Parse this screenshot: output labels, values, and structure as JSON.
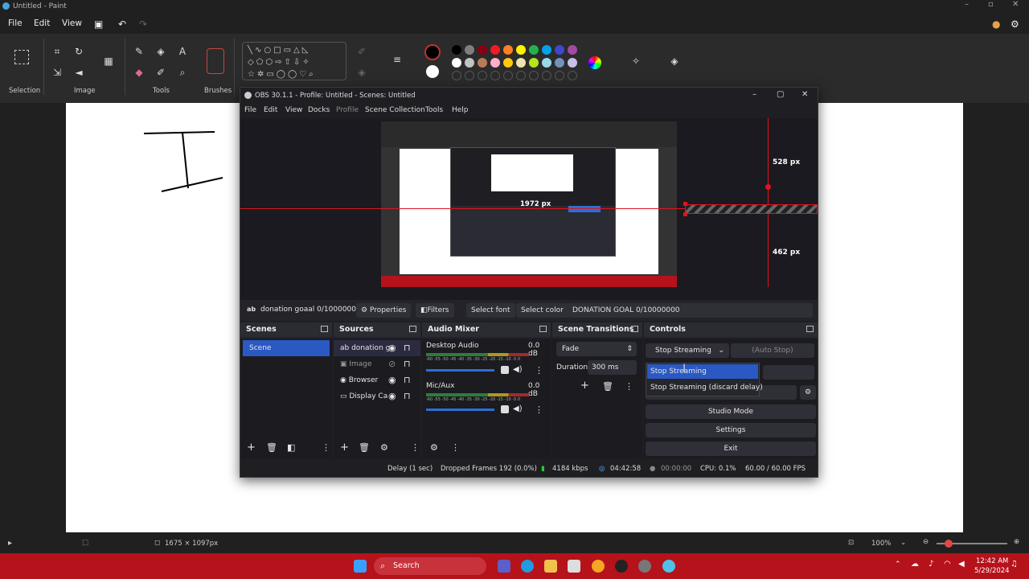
{
  "paint": {
    "title": "Untitled - Paint",
    "menu": [
      "File",
      "Edit",
      "View"
    ],
    "groups": [
      "Selection",
      "Image",
      "Tools",
      "Brushes"
    ],
    "canvas_text": "I",
    "status_size": "1675 × 1097px",
    "zoom": "100%"
  },
  "obs": {
    "title": "OBS 30.1.1 - Profile: Untitled - Scenes: Untitled",
    "menu": [
      "File",
      "Edit",
      "View",
      "Docks",
      "Profile",
      "Scene Collection",
      "Tools",
      "Help"
    ],
    "preview": {
      "width_label": "1972 px",
      "top_label": "528 px",
      "bottom_label": "462 px"
    },
    "source_bar": {
      "source_name": "donation goaal 0/1000000",
      "properties": "Properties",
      "filters": "Filters",
      "select_font": "Select font",
      "select_color": "Select color",
      "text_value": "DONATION GOAL 0/10000000"
    },
    "scenes": {
      "header": "Scenes",
      "items": [
        "Scene"
      ]
    },
    "sources": {
      "header": "Sources",
      "items": [
        "donation g",
        "Image",
        "Browser",
        "Display Ca"
      ]
    },
    "mixer": {
      "header": "Audio Mixer",
      "channels": [
        {
          "name": "Desktop Audio",
          "db": "0.0 dB",
          "level": 0.85
        },
        {
          "name": "Mic/Aux",
          "db": "0.0 dB",
          "level": 0.85
        }
      ],
      "scale": "-60 -55 -50 -45 -40 -35 -30 -25 -20 -15 -10 -5 0"
    },
    "transitions": {
      "header": "Scene Transitions",
      "type": "Fade",
      "duration_label": "Duration",
      "duration_value": "300 ms"
    },
    "controls": {
      "header": "Controls",
      "stream_button": "Stop Streaming",
      "auto_stop": "(Auto Stop)",
      "dropdown": [
        "Stop Streaming",
        "Stop Streaming (discard delay)"
      ],
      "studio_mode": "Studio Mode",
      "settings": "Settings",
      "exit": "Exit"
    },
    "status": {
      "delay": "Delay (1 sec)",
      "dropped": "Dropped Frames 192 (0.0%)",
      "kbps": "4184 kbps",
      "stream_time": "04:42:58",
      "rec_time": "00:00:00",
      "cpu": "CPU: 0.1%",
      "fps": "60.00 / 60.00 FPS"
    }
  },
  "taskbar": {
    "search": "Search",
    "time": "12:42 AM",
    "date": "5/29/2024"
  },
  "colors": {
    "taskbar": "#b5121b",
    "accent": "#2b6fd6",
    "red_guide": "#e0141e"
  }
}
